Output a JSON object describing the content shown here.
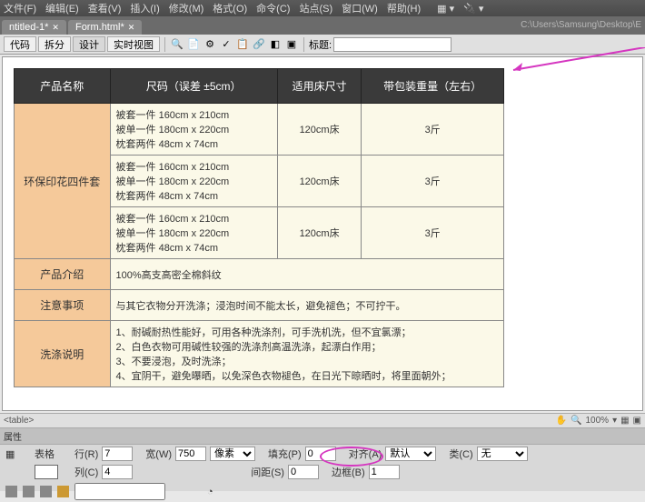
{
  "menu": {
    "file": "文件(F)",
    "edit": "编辑(E)",
    "view": "查看(V)",
    "insert": "插入(I)",
    "modify": "修改(M)",
    "format": "格式(O)",
    "command": "命令(C)",
    "site": "站点(S)",
    "window": "窗口(W)",
    "help": "帮助(H)"
  },
  "tabs": {
    "t1": "ntitled-1*",
    "t2": "Form.html*"
  },
  "path": "C:\\Users\\Samsung\\Desktop\\E",
  "toolbar": {
    "code": "代码",
    "split": "拆分",
    "design": "设计",
    "live": "实时视图",
    "title_label": "标题:"
  },
  "headers": {
    "h1": "产品名称",
    "h2": "尺码（误差 ±5cm）",
    "h3": "适用床尺寸",
    "h4": "带包装重量（左右）"
  },
  "specs": {
    "s1": "被套一件 160cm x 210cm",
    "s2": "被单一件 180cm x 220cm",
    "s3": "枕套两件 48cm x 74cm"
  },
  "bed": "120cm床",
  "weight": "3斤",
  "labels": {
    "name": "环保印花四件套",
    "intro": "产品介绍",
    "notice": "注意事项",
    "wash": "洗涤说明"
  },
  "intro": "100%高支高密全棉斜纹",
  "notice": "与其它衣物分开洗涤；浸泡时间不能太长，避免褪色；不可拧干。",
  "wash": {
    "w1": "1、耐碱耐热性能好，可用各种洗涤剂，可手洗机洗，但不宜氯漂；",
    "w2": "2、白色衣物可用碱性较强的洗涤剂高温洗涤，起漂白作用；",
    "w3": "3、不要浸泡，及时洗涤；",
    "w4": "4、宜阴干，避免曝晒，以免深色衣物褪色，在日光下晾晒时，将里面朝外；"
  },
  "status": {
    "tag": "<table>",
    "zoom": "100%"
  },
  "prop": {
    "panel": "属性",
    "section": "表格",
    "rows_l": "行(R)",
    "rows_v": "7",
    "cols_l": "列(C)",
    "cols_v": "4",
    "width_l": "宽(W)",
    "width_v": "750",
    "width_u": "像素",
    "pad_l": "填充(P)",
    "pad_v": "0",
    "space_l": "间距(S)",
    "space_v": "0",
    "align_l": "对齐(A)",
    "align_v": "默认",
    "border_l": "边框(B)",
    "border_v": "1",
    "class_l": "类(C)",
    "class_v": "无"
  }
}
